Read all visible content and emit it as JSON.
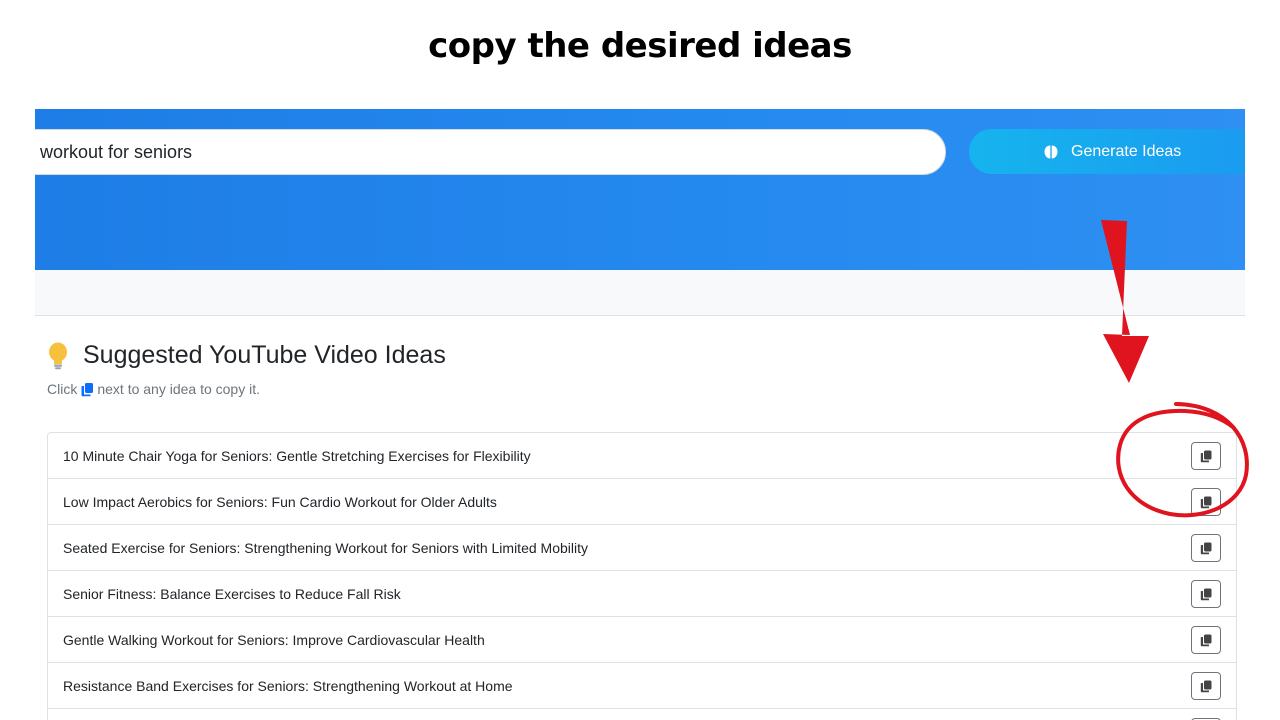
{
  "caption": "copy the desired ideas",
  "search": {
    "value": "workout for seniors"
  },
  "generate_button": {
    "label": "Generate Ideas",
    "icon": "brain-icon"
  },
  "section": {
    "title": "Suggested YouTube Video Ideas",
    "title_icon": "lightbulb-icon",
    "hint_prefix": "Click",
    "hint_suffix": "next to any idea to copy it."
  },
  "ideas": [
    "10 Minute Chair Yoga for Seniors: Gentle Stretching Exercises for Flexibility",
    "Low Impact Aerobics for Seniors: Fun Cardio Workout for Older Adults",
    "Seated Exercise for Seniors: Strengthening Workout for Seniors with Limited Mobility",
    "Senior Fitness: Balance Exercises to Reduce Fall Risk",
    "Gentle Walking Workout for Seniors: Improve Cardiovascular Health",
    "Resistance Band Exercises for Seniors: Strengthening Workout at Home",
    ""
  ],
  "colors": {
    "hero_blue": "#1e7de6",
    "button_cyan": "#16b4ee",
    "annotation_red": "#e0141e",
    "bulb_yellow": "#f6c23e",
    "copy_blue": "#0d6efd"
  }
}
